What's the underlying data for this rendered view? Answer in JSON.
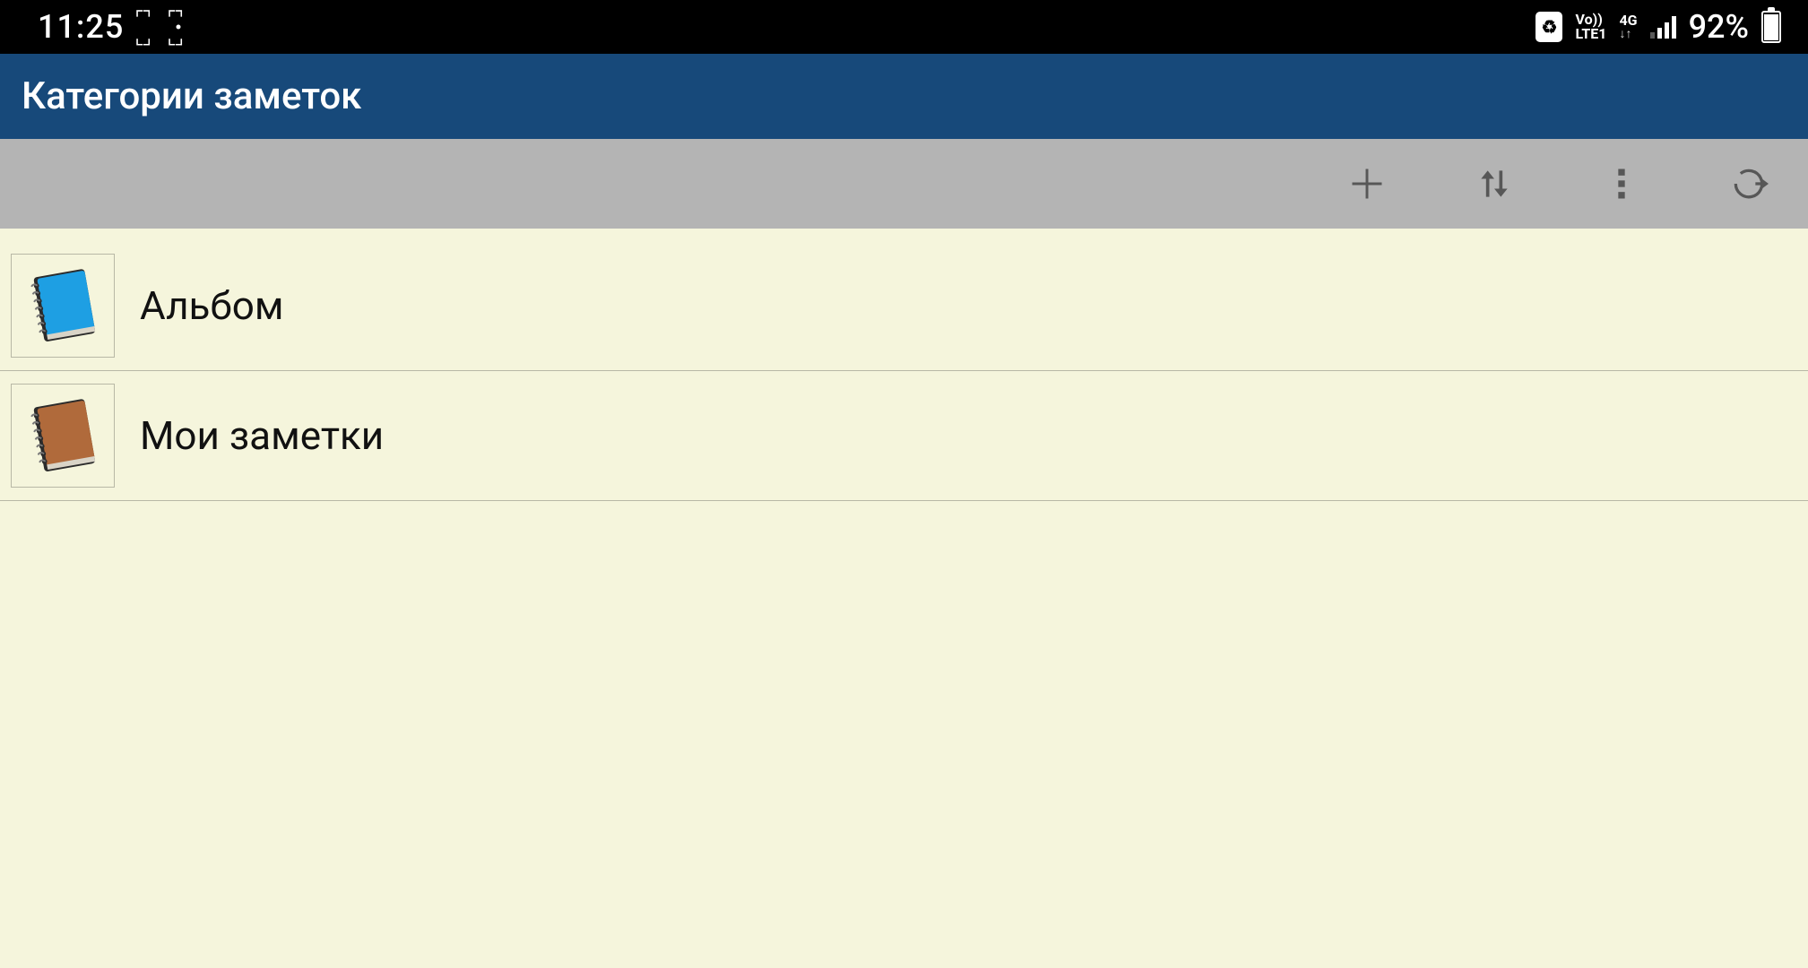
{
  "status": {
    "time": "11:25",
    "vo_label_top": "Vo))",
    "vo_label_bottom": "LTE1",
    "net_gen": "4G",
    "battery_percent_text": "92%",
    "battery_fill_percent": 92
  },
  "header": {
    "title": "Категории заметок"
  },
  "toolbar": {
    "add_icon": "plus-icon",
    "sort_icon": "sort-arrows-icon",
    "more_icon": "more-vertical-icon",
    "exit_icon": "exit-icon"
  },
  "categories": [
    {
      "label": "Альбом",
      "icon_color": "#1e9fe3",
      "icon_name": "notebook-blue-icon"
    },
    {
      "label": "Мои заметки",
      "icon_color": "#b06a3b",
      "icon_name": "notebook-brown-icon"
    }
  ]
}
